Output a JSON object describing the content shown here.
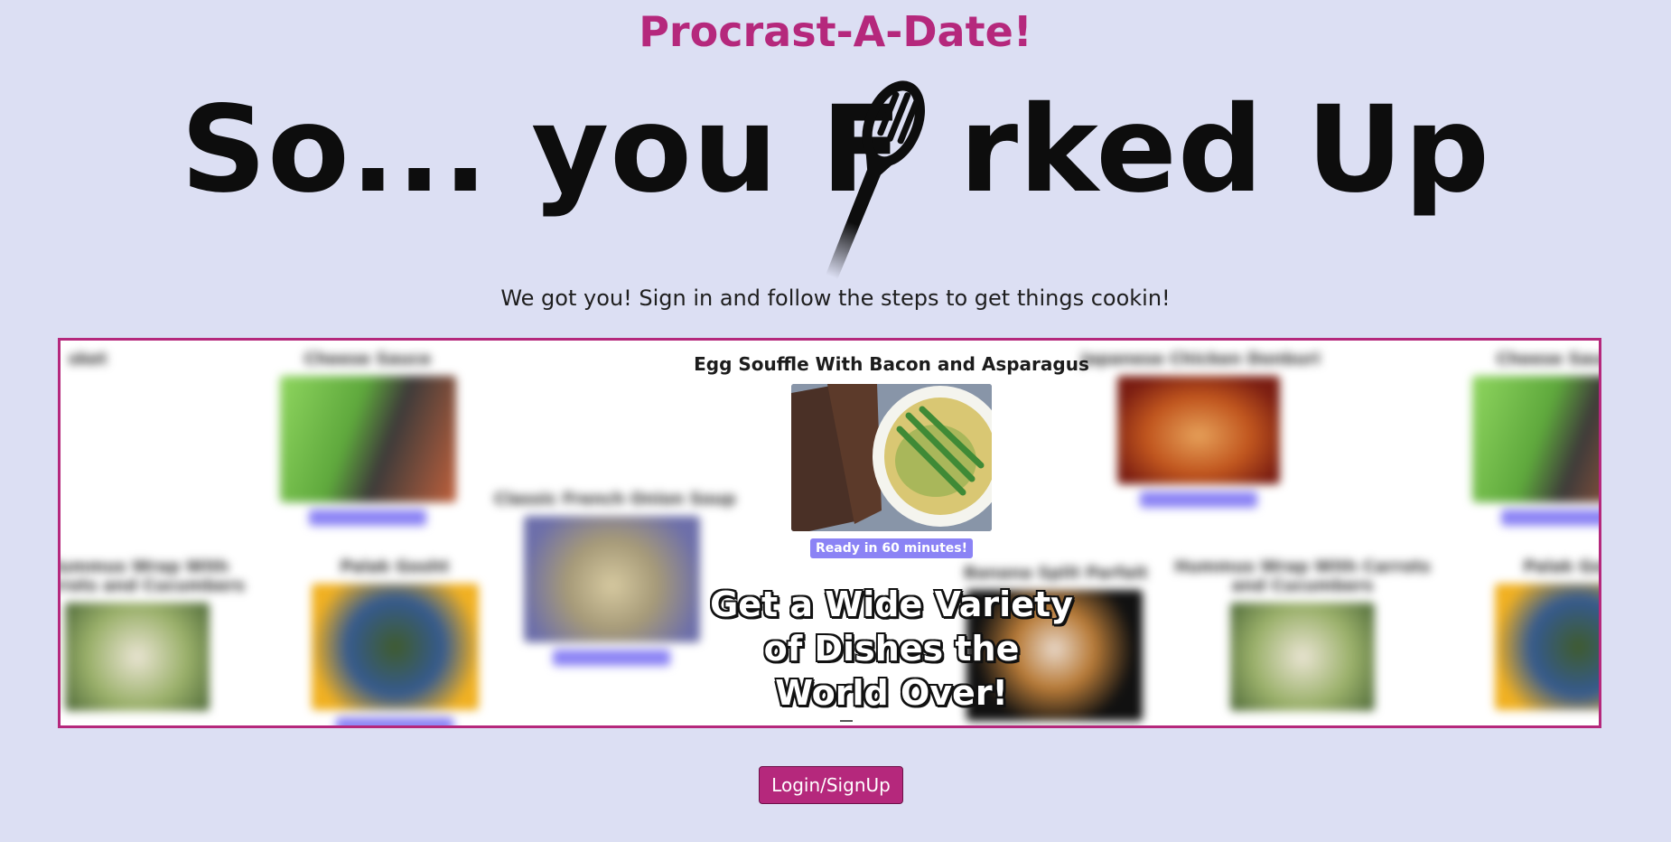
{
  "brand": "Procrast-A-Date!",
  "hero": {
    "part1": "So... you F",
    "part2": "rked Up",
    "fork_icon": "fork-icon"
  },
  "subtitle": "We got you! Sign in and follow the steps to get things cookin!",
  "carousel": {
    "featured": {
      "title": "Egg Souffle With Bacon and Asparagus",
      "badge": "Ready in 60 minutes!"
    },
    "overlay_lines": [
      "Get a Wide Variety",
      "of Dishes the",
      "World Over!"
    ],
    "background_cards": [
      {
        "title": "Cheese Sauce"
      },
      {
        "title": "Classic French Onion Soup"
      },
      {
        "title": "Japanese Chicken Donburi"
      },
      {
        "title": "Cheese Sauce"
      },
      {
        "title": "Hummus Wrap With Carrots and Cucumbers"
      },
      {
        "title": "Palak Gosht"
      },
      {
        "title": "Banana Split Parfait"
      },
      {
        "title": "Hummus Wrap With Carrots and Cucumbers"
      },
      {
        "title": "Palak Gosht"
      }
    ]
  },
  "login_button": "Login/SignUp",
  "colors": {
    "accent": "#b5287c",
    "background": "#dcdff3",
    "badge": "#8b83f5"
  }
}
